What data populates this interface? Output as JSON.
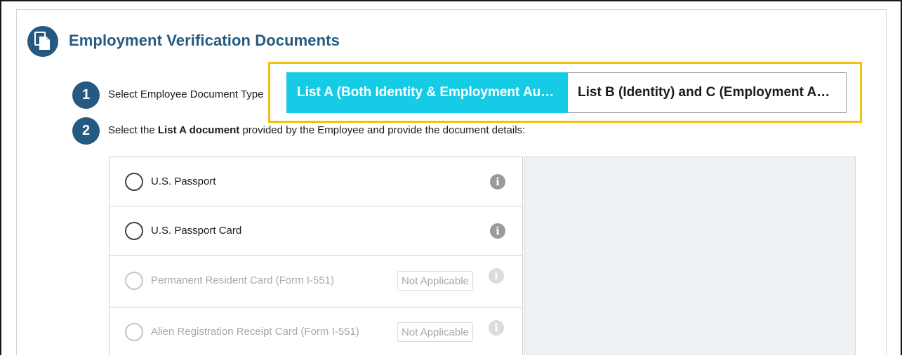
{
  "section": {
    "title": "Employment Verification Documents",
    "icon": "documents-icon",
    "accent_color": "#245a82"
  },
  "steps": [
    {
      "number": "1",
      "text": "Select Employee Document Type"
    },
    {
      "number": "2",
      "text_before": "Select the ",
      "text_bold": "List A document",
      "text_after": " provided by the Employee and provide the document details:"
    }
  ],
  "document_type_toggle": {
    "options": [
      {
        "label": "List A (Both Identity & Employment Authorization)",
        "selected": true
      },
      {
        "label": "List B (Identity) and C (Employment Authorization)",
        "selected": false
      }
    ],
    "selected_color": "#15cbe6",
    "highlight_color": "#f4c20d"
  },
  "documents": [
    {
      "label": "U.S. Passport",
      "enabled": true,
      "badge": ""
    },
    {
      "label": "U.S. Passport Card",
      "enabled": true,
      "badge": ""
    },
    {
      "label": "Permanent Resident Card (Form I-551)",
      "enabled": false,
      "badge": "Not Applicable"
    },
    {
      "label": "Alien Registration Receipt Card (Form I-551)",
      "enabled": false,
      "badge": "Not Applicable"
    }
  ]
}
